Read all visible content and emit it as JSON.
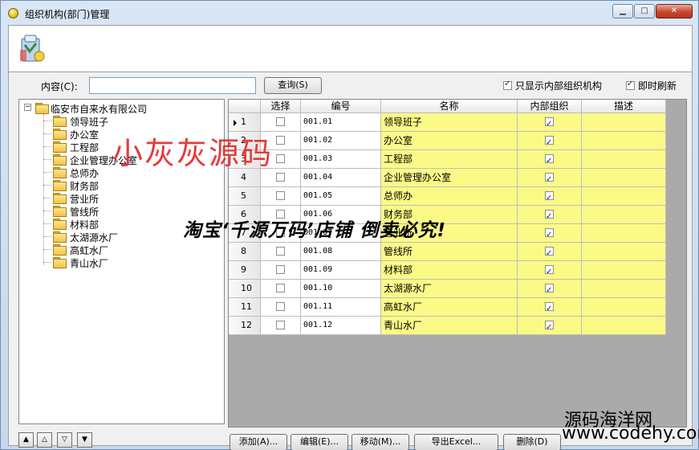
{
  "window": {
    "title": "组织机构(部门)管理",
    "min_glyph": "▁",
    "max_glyph": "□",
    "close_glyph": "✕"
  },
  "search": {
    "label": "内容(C):",
    "value": "",
    "query_label": "查询(S)",
    "only_internal_label": "只显示内部组织机构",
    "only_internal_checked": true,
    "auto_refresh_label": "即时刷新",
    "auto_refresh_checked": true
  },
  "tree": {
    "root": "临安市自来水有限公司",
    "items": [
      "领导班子",
      "办公室",
      "工程部",
      "企业管理办公室",
      "总师办",
      "财务部",
      "营业所",
      "管线所",
      "材料部",
      "太湖源水厂",
      "高虹水厂",
      "青山水厂"
    ]
  },
  "nav_buttons": [
    "▲",
    "△",
    "▽",
    "▼"
  ],
  "grid": {
    "columns": [
      "选择",
      "编号",
      "名称",
      "内部组织",
      "描述"
    ],
    "rows": [
      {
        "num": "1",
        "code": "001.01",
        "name": "领导班子",
        "selected": false,
        "internal": true,
        "desc": ""
      },
      {
        "num": "2",
        "code": "001.02",
        "name": "办公室",
        "selected": false,
        "internal": true,
        "desc": ""
      },
      {
        "num": "3",
        "code": "001.03",
        "name": "工程部",
        "selected": false,
        "internal": true,
        "desc": ""
      },
      {
        "num": "4",
        "code": "001.04",
        "name": "企业管理办公室",
        "selected": false,
        "internal": true,
        "desc": ""
      },
      {
        "num": "5",
        "code": "001.05",
        "name": "总师办",
        "selected": false,
        "internal": true,
        "desc": ""
      },
      {
        "num": "6",
        "code": "001.06",
        "name": "财务部",
        "selected": false,
        "internal": true,
        "desc": ""
      },
      {
        "num": "7",
        "code": "001.07",
        "name": "营业所",
        "selected": false,
        "internal": true,
        "desc": ""
      },
      {
        "num": "8",
        "code": "001.08",
        "name": "管线所",
        "selected": false,
        "internal": true,
        "desc": ""
      },
      {
        "num": "9",
        "code": "001.09",
        "name": "材料部",
        "selected": false,
        "internal": true,
        "desc": ""
      },
      {
        "num": "10",
        "code": "001.10",
        "name": "太湖源水厂",
        "selected": false,
        "internal": true,
        "desc": ""
      },
      {
        "num": "11",
        "code": "001.11",
        "name": "高虹水厂",
        "selected": false,
        "internal": true,
        "desc": ""
      },
      {
        "num": "12",
        "code": "001.12",
        "name": "青山水厂",
        "selected": false,
        "internal": true,
        "desc": ""
      }
    ]
  },
  "actions": {
    "add": "添加(A)...",
    "edit": "编辑(E)...",
    "move": "移动(M)...",
    "export": "导出Excel...",
    "delete": "删除(D)"
  },
  "watermarks": {
    "red": "小灰灰源码",
    "black": "淘宝‘千源万码’店铺  倒卖必究!",
    "site_cn": "源码海洋网",
    "site_url": "www.codehy.com"
  },
  "colors": {
    "name_cell_bg": "#fbfa87",
    "grid_bg": "#aaaaaa",
    "title_bar": "#d8e6f5"
  }
}
